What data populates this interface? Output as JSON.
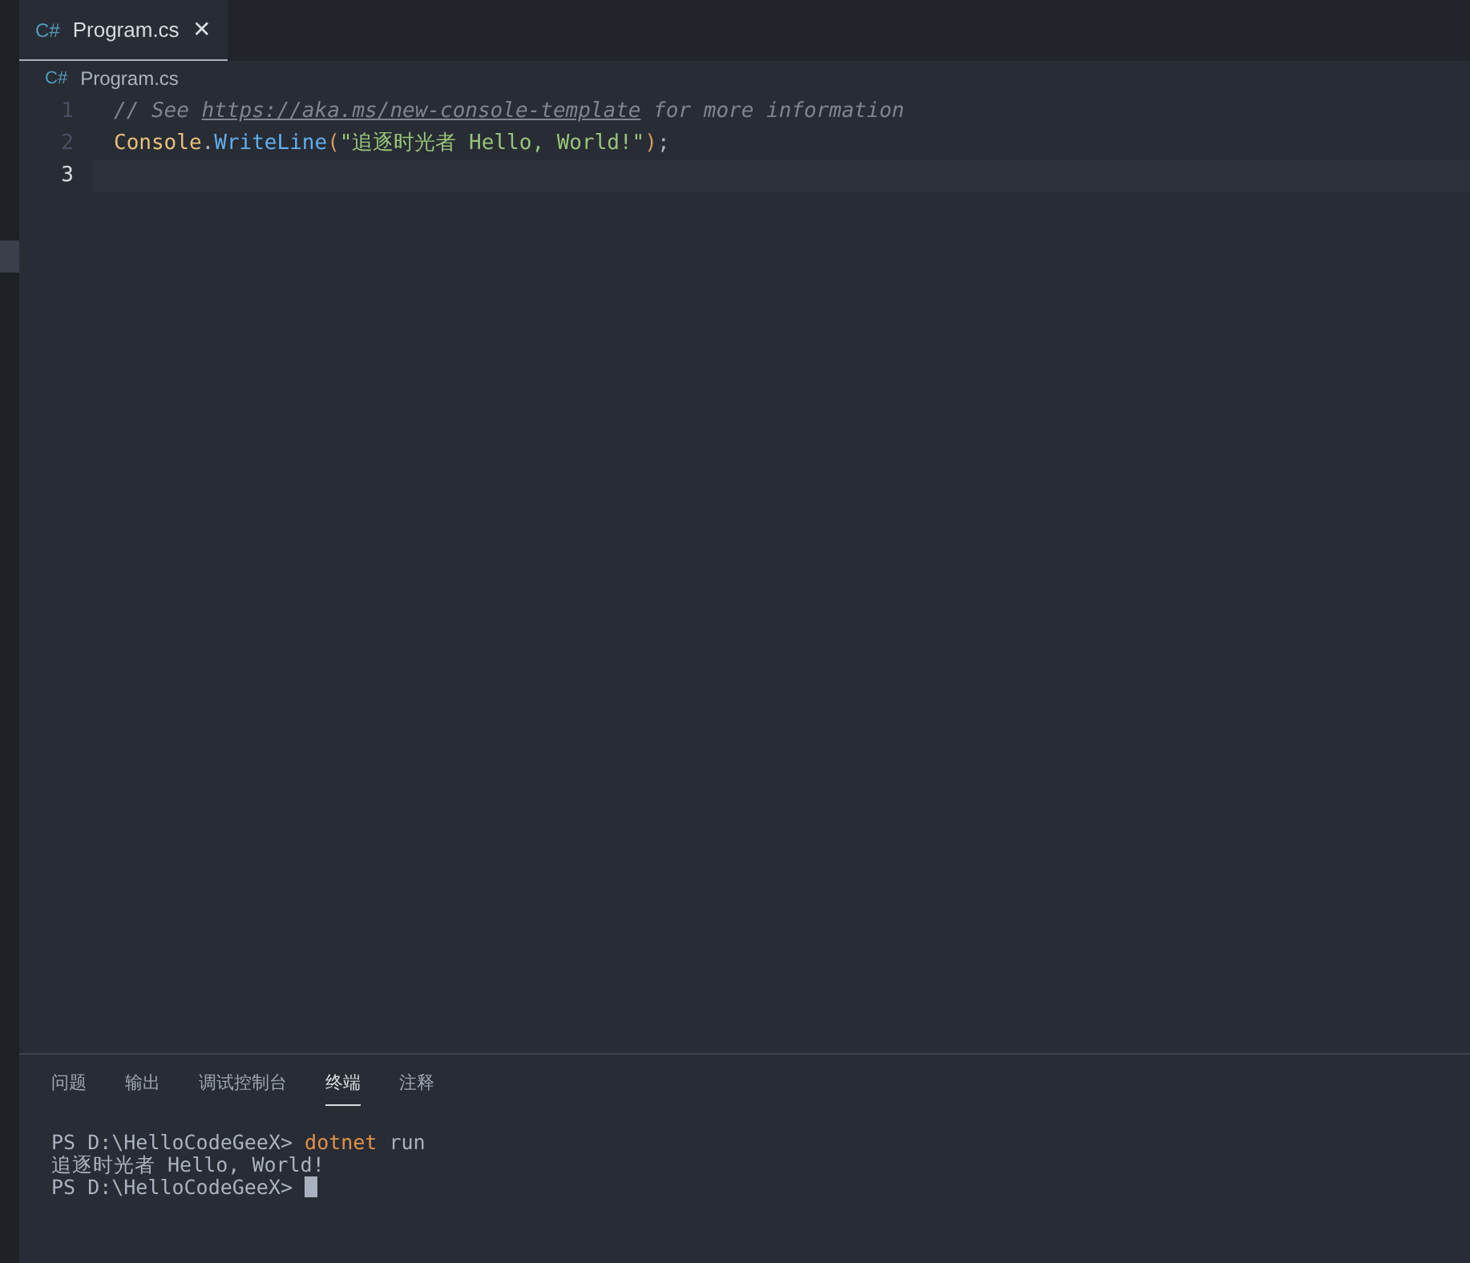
{
  "tabs": [
    {
      "icon": "C#",
      "label": "Program.cs",
      "selected": true,
      "close": "✕"
    }
  ],
  "breadcrumb": {
    "icon": "C#",
    "label": "Program.cs"
  },
  "editor": {
    "lines": [
      {
        "number": "1",
        "current": false,
        "tokens": [
          {
            "kind": "comment",
            "text": "// See "
          },
          {
            "kind": "link",
            "text": "https://aka.ms/new-console-template"
          },
          {
            "kind": "comment",
            "text": " for more information"
          }
        ]
      },
      {
        "number": "2",
        "current": false,
        "tokens": [
          {
            "kind": "type",
            "text": "Console"
          },
          {
            "kind": "plain",
            "text": "."
          },
          {
            "kind": "method",
            "text": "WriteLine"
          },
          {
            "kind": "paren",
            "text": "("
          },
          {
            "kind": "string",
            "text": "\"追逐时光者 Hello, World!\""
          },
          {
            "kind": "paren",
            "text": ")"
          },
          {
            "kind": "plain",
            "text": ";"
          }
        ]
      },
      {
        "number": "3",
        "current": true
      }
    ]
  },
  "panel": {
    "tabs": [
      {
        "label": "问题",
        "selected": false
      },
      {
        "label": "输出",
        "selected": false
      },
      {
        "label": "调试控制台",
        "selected": false
      },
      {
        "label": "终端",
        "selected": true
      },
      {
        "label": "注释",
        "selected": false
      }
    ],
    "terminal": [
      {
        "tokens": [
          {
            "kind": "prompt",
            "text": "PS D:\\HelloCodeGeeX> "
          },
          {
            "kind": "command",
            "text": "dotnet"
          },
          {
            "kind": "plain",
            "text": " run"
          }
        ],
        "cursor": false
      },
      {
        "tokens": [
          {
            "kind": "plain",
            "text": "追逐时光者 Hello, World!"
          }
        ],
        "cursor": false
      },
      {
        "tokens": [
          {
            "kind": "prompt",
            "text": "PS D:\\HelloCodeGeeX> "
          }
        ],
        "cursor": true
      }
    ]
  }
}
